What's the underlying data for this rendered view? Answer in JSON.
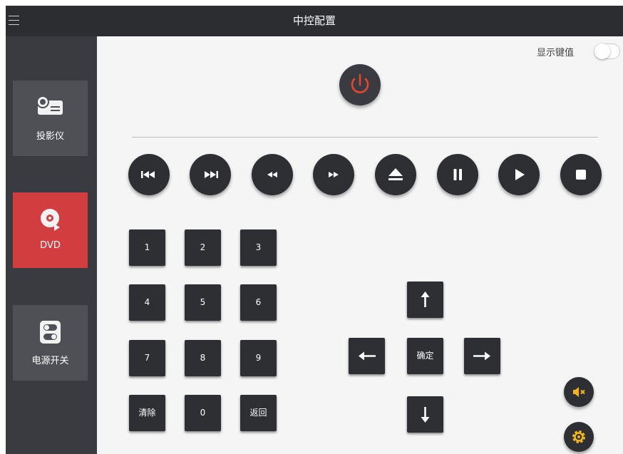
{
  "header": {
    "title": "中控配置",
    "menu_icon": "hamburger-menu-icon"
  },
  "sidebar": {
    "items": [
      {
        "label": "投影仪",
        "icon": "projector-icon",
        "active": false
      },
      {
        "label": "DVD",
        "icon": "dvd-disc-icon",
        "active": true
      },
      {
        "label": "电源开关",
        "icon": "power-switch-icon",
        "active": false
      }
    ]
  },
  "toolbar": {
    "show_keys_label": "显示键值",
    "show_keys_on": false
  },
  "power_button": {
    "icon": "power-icon"
  },
  "transport": {
    "buttons": [
      {
        "icon": "skip-previous-icon"
      },
      {
        "icon": "skip-next-icon"
      },
      {
        "icon": "rewind-icon"
      },
      {
        "icon": "fast-forward-icon"
      },
      {
        "icon": "eject-icon"
      },
      {
        "icon": "pause-icon"
      },
      {
        "icon": "play-icon"
      },
      {
        "icon": "stop-icon"
      }
    ]
  },
  "keypad": {
    "keys": [
      "1",
      "2",
      "3",
      "4",
      "5",
      "6",
      "7",
      "8",
      "9",
      "清除",
      "0",
      "返回"
    ]
  },
  "dpad": {
    "ok_label": "确定",
    "up_icon": "arrow-up-icon",
    "down_icon": "arrow-down-icon",
    "left_icon": "arrow-left-icon",
    "right_icon": "arrow-right-icon"
  },
  "floating": {
    "mute_icon": "mute-icon",
    "settings_icon": "settings-gear-icon"
  },
  "colors": {
    "titlebar": "#2b2d31",
    "sidebar": "#3a3b40",
    "sidebar_item": "#4f5055",
    "active": "#d23d40",
    "power_red": "#e8452f",
    "accent_yellow": "#f2b51c"
  }
}
